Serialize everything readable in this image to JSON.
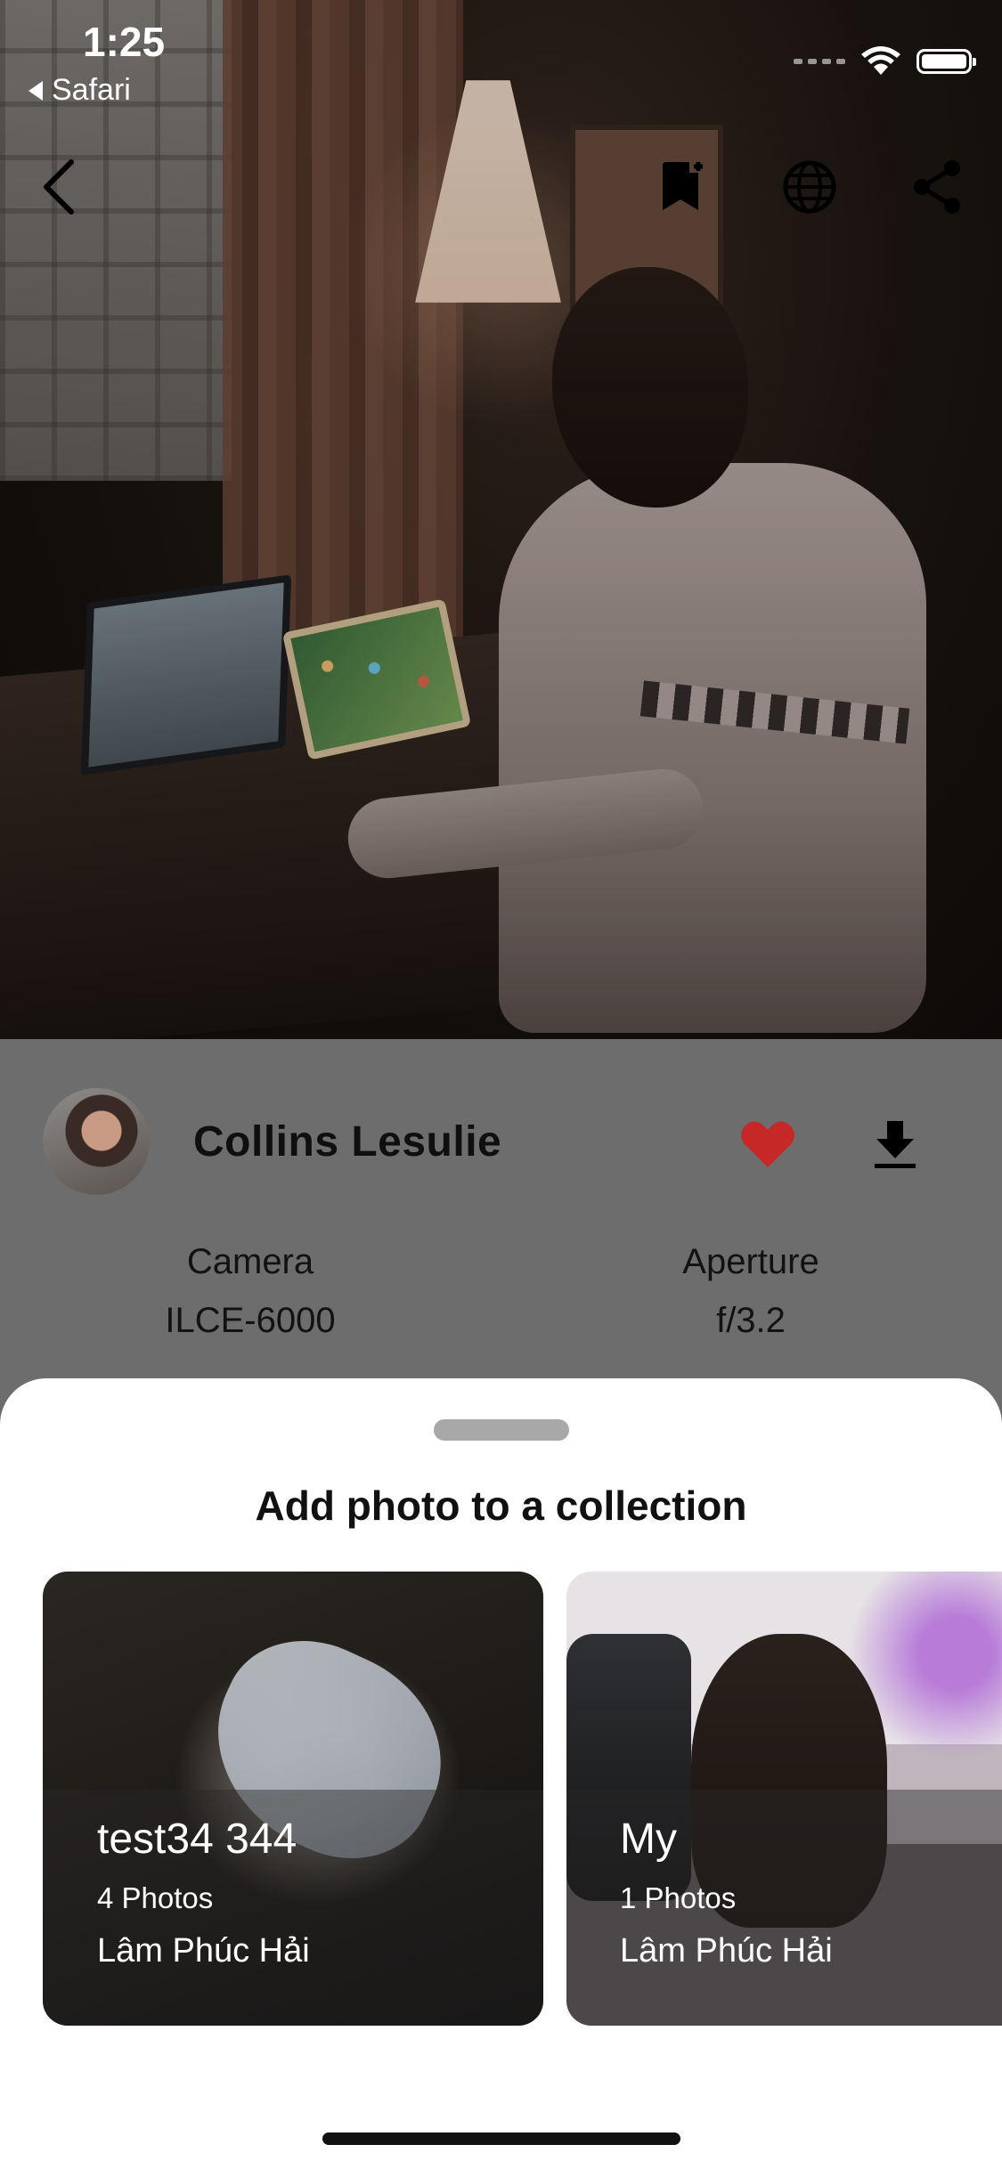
{
  "status_bar": {
    "time": "1:25",
    "back_app": "Safari"
  },
  "top_nav": {
    "back_icon": "chevron-left-icon",
    "bookmark_icon": "bookmark-add-icon",
    "globe_icon": "globe-icon",
    "share_icon": "share-icon"
  },
  "photo_info": {
    "author_name": "Collins Lesulie",
    "liked": true,
    "like_color": "#c62828",
    "camera_label": "Camera",
    "camera_value": "ILCE-6000",
    "aperture_label": "Aperture",
    "aperture_value": "f/3.2"
  },
  "sheet": {
    "title": "Add photo to a collection",
    "collections": [
      {
        "title": "test34 344",
        "count": "4 Photos",
        "owner": "Lâm Phúc Hải"
      },
      {
        "title": "My",
        "count": "1 Photos",
        "owner": "Lâm Phúc Hải"
      }
    ]
  }
}
